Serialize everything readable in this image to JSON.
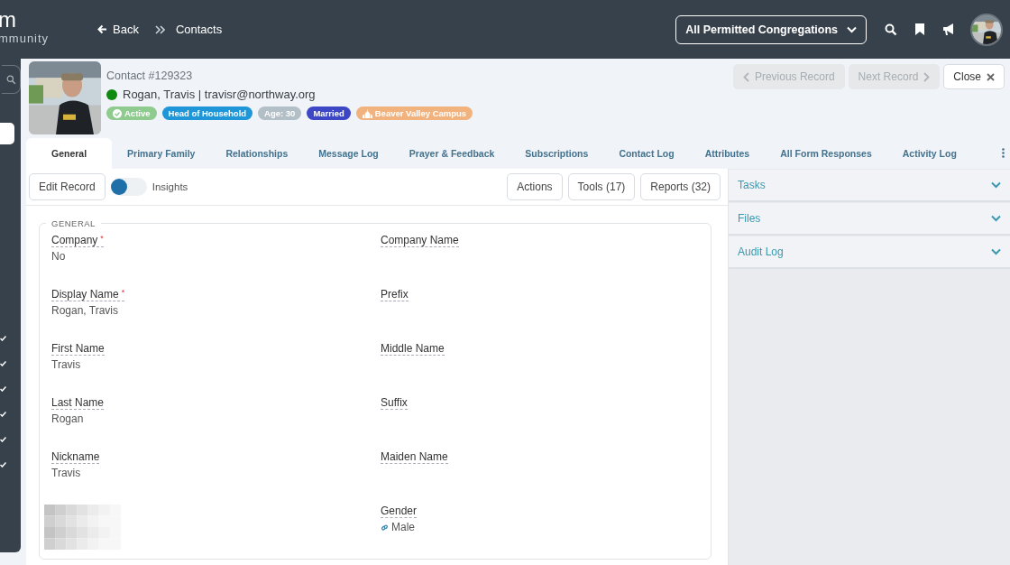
{
  "brand": {
    "logo": "m",
    "tagline": "mmunity"
  },
  "nav": {
    "back": "Back",
    "breadcrumb": "Contacts"
  },
  "congregation_select": {
    "value": "All Permitted Congregations"
  },
  "contact": {
    "number": "Contact #129323",
    "name_line": "Rogan, Travis | travisr@northway.org",
    "badges": [
      {
        "label": "Active",
        "color": "#8fca8f",
        "kind": "check"
      },
      {
        "label": "Head of Household",
        "color": "#1e96d8",
        "kind": "plain"
      },
      {
        "label": "Age: 30",
        "color": "#b3bfc7",
        "kind": "plain"
      },
      {
        "label": "Married",
        "color": "#3d47c6",
        "kind": "plain"
      },
      {
        "label": "Beaver Valley Campus",
        "color": "#f2b27e",
        "kind": "campus"
      }
    ]
  },
  "record_nav": [
    {
      "label": "Previous Record",
      "kind": "prev",
      "disabled": true
    },
    {
      "label": "Next Record",
      "kind": "next",
      "disabled": true
    },
    {
      "label": "Close",
      "kind": "close",
      "disabled": false
    }
  ],
  "tabs": [
    {
      "label": "General",
      "selected": true
    },
    {
      "label": "Primary Family",
      "selected": false
    },
    {
      "label": "Relationships",
      "selected": false
    },
    {
      "label": "Message Log",
      "selected": false
    },
    {
      "label": "Prayer & Feedback",
      "selected": false
    },
    {
      "label": "Subscriptions",
      "selected": false
    },
    {
      "label": "Contact Log",
      "selected": false
    },
    {
      "label": "Attributes",
      "selected": false
    },
    {
      "label": "All Form Responses",
      "selected": false
    },
    {
      "label": "Activity Log",
      "selected": false
    }
  ],
  "toolbar": {
    "edit": "Edit Record",
    "insights": {
      "label": "Insights",
      "on": false
    },
    "buttons": [
      "Actions",
      "Tools (17)",
      "Reports (32)"
    ]
  },
  "section": {
    "title": "GENERAL",
    "fields": [
      {
        "kind": "field",
        "label": "Company",
        "required_mark": "*",
        "value": "No"
      },
      {
        "kind": "field",
        "label": "Company Name"
      },
      {
        "kind": "field",
        "label": "Display Name",
        "required_mark": "*",
        "value": "Rogan, Travis"
      },
      {
        "kind": "field",
        "label": "Prefix"
      },
      {
        "kind": "field",
        "label": "First Name",
        "value": "Travis"
      },
      {
        "kind": "field",
        "label": "Middle Name"
      },
      {
        "kind": "field",
        "label": "Last Name",
        "value": "Rogan"
      },
      {
        "kind": "field",
        "label": "Suffix"
      },
      {
        "kind": "field",
        "label": "Nickname",
        "value": "Travis"
      },
      {
        "kind": "field",
        "label": "Maiden Name"
      },
      {
        "kind": "picture"
      },
      {
        "kind": "field",
        "label": "Gender",
        "value": "Male",
        "link": true
      }
    ]
  },
  "side_panels": [
    "Tasks",
    "Files",
    "Audit Log"
  ]
}
